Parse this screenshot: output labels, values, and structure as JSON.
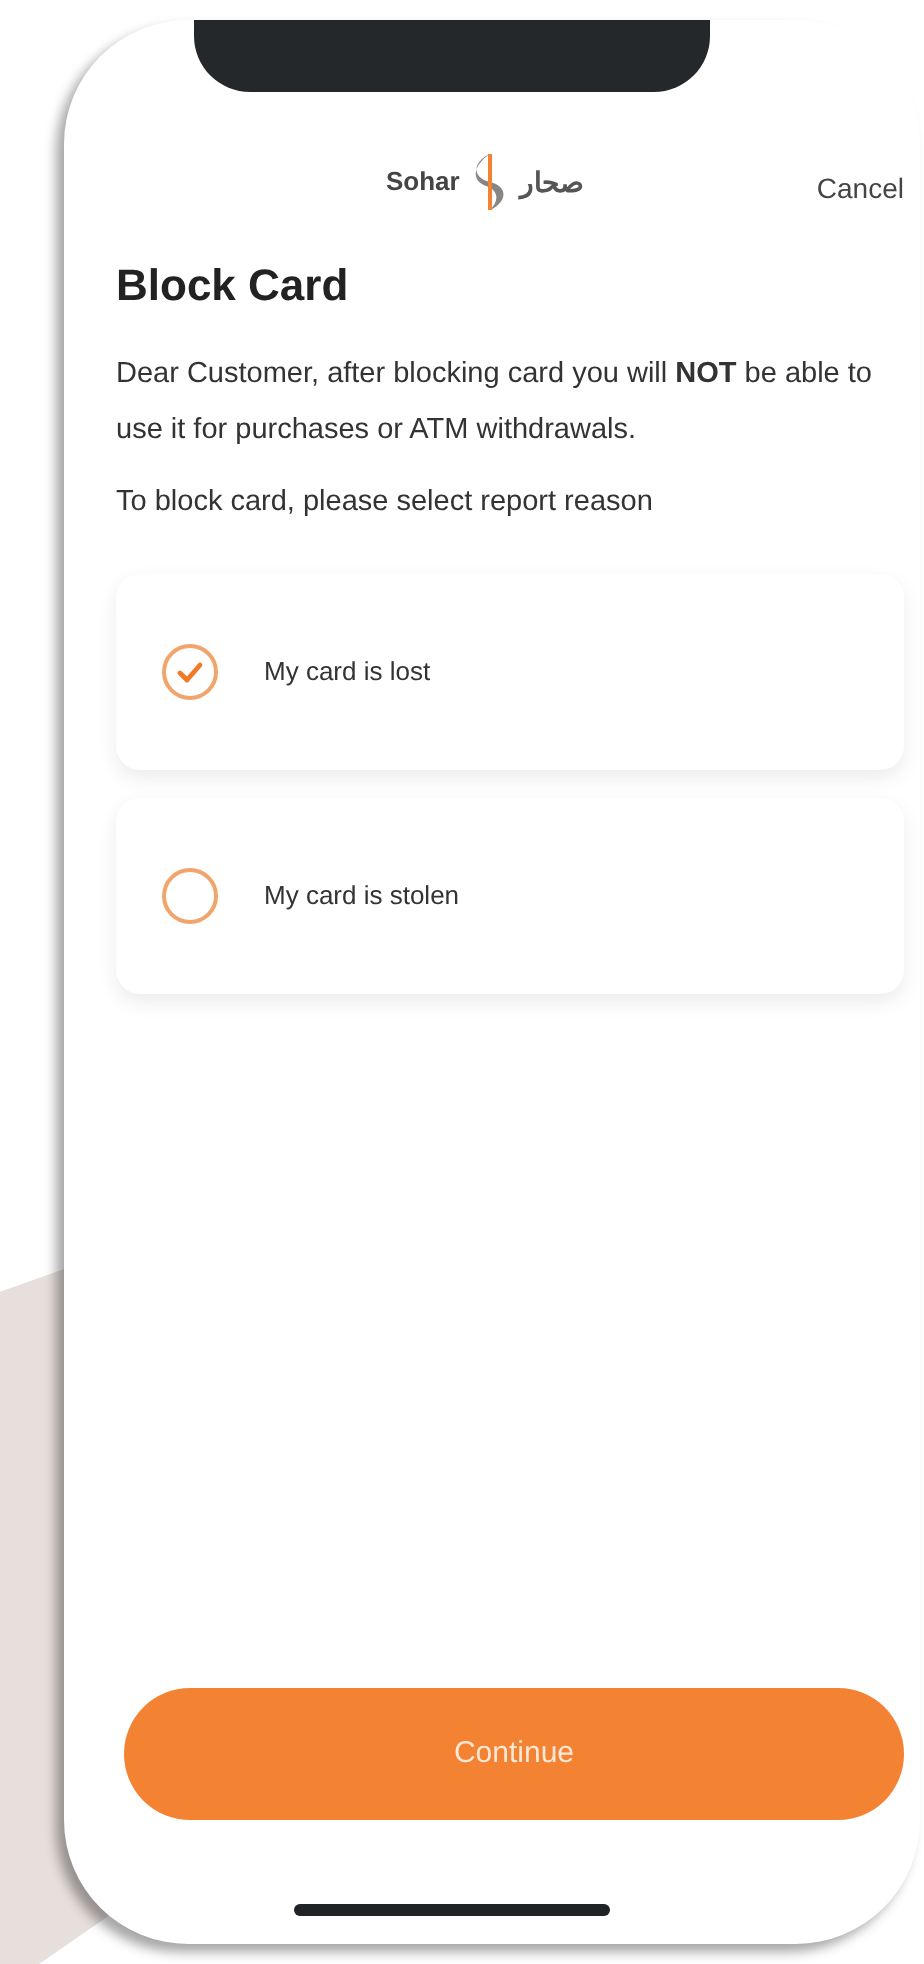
{
  "header": {
    "logo": {
      "latin": "Sohar",
      "arabic": "صحار"
    },
    "cancel": "Cancel"
  },
  "title": "Block Card",
  "message": "Dear Customer, after blocking card you will **NOT** be able to use it for purchases or ATM withdrawals.",
  "instruction": "To block card, please select report reason",
  "reasons": [
    {
      "label": "My card is lost",
      "selected": true
    },
    {
      "label": "My card is stolen",
      "selected": false
    }
  ],
  "button": "Continue"
}
